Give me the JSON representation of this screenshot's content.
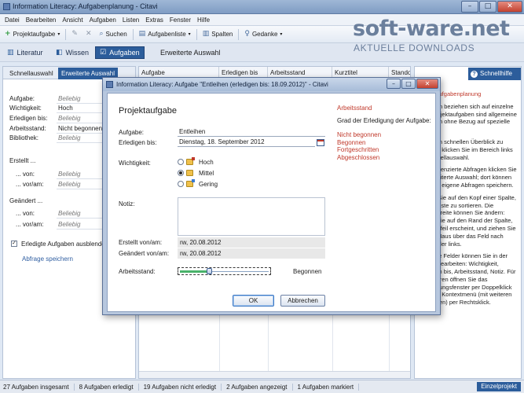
{
  "window": {
    "title": "Information Literacy: Aufgabenplanung - Citavi",
    "controls": [
      "–",
      "□",
      "✕"
    ]
  },
  "menu": [
    "Datei",
    "Bearbeiten",
    "Ansicht",
    "Aufgaben",
    "Listen",
    "Extras",
    "Fenster",
    "Hilfe"
  ],
  "toolbar": {
    "projektaufgabe": "Projektaufgabe",
    "suchen": "Suchen",
    "aufgabenliste": "Aufgabenliste",
    "spalten": "Spalten",
    "gedanke": "Gedanke"
  },
  "watermark": {
    "name": "soft-ware.net",
    "tagline": "AKTUELLE DOWNLOADS"
  },
  "nav": {
    "literatur": "Literatur",
    "wissen": "Wissen",
    "aufgaben": "Aufgaben",
    "heading": "Erweiterte Auswahl"
  },
  "left_panel": {
    "tabs": [
      "Schnellauswahl",
      "Erweiterte Auswahl"
    ],
    "fields": [
      {
        "label": "Aufgabe:",
        "value": "Beliebig",
        "filled": false
      },
      {
        "label": "Wichtigkeit:",
        "value": "Hoch",
        "filled": true
      },
      {
        "label": "Erledigen bis:",
        "value": "Beliebig",
        "filled": false
      },
      {
        "label": "Arbeitsstand:",
        "value": "Nicht begonnen",
        "filled": true
      },
      {
        "label": "Bibliothek:",
        "value": "Beliebig",
        "filled": false
      }
    ],
    "erstellt": "Erstellt ...",
    "erstellt_von": {
      "label": "... von:",
      "value": "Beliebig"
    },
    "erstellt_vonam": {
      "label": "... vor/am:",
      "value": "Beliebig"
    },
    "geaendert": "Geändert ...",
    "geaendert_von": {
      "label": "... von:",
      "value": "Beliebig"
    },
    "geaendert_vonam": {
      "label": "... vor/am:",
      "value": "Beliebig"
    },
    "checkbox_label": "Erledigte Aufgaben ausblenden",
    "checkbox_checked": true,
    "save_link": "Abfrage speichern"
  },
  "table": {
    "columns": [
      "Aufgabe",
      "Erledigen bis",
      "Arbeitsstand",
      "Kurztitel",
      "Stando"
    ]
  },
  "right_panel": {
    "header": "Schnellhilfe",
    "heading": "Projektaufgabenplanung",
    "paragraphs": [
      "Aufgaben beziehen sich auf einzelne Titel. Projektaufgaben sind allgemeine Aufgaben ohne Bezug auf spezielle Titel.",
      "Um einen schnellen Überblick zu erhalten, klicken Sie im Bereich links auf Schnellauswahl.",
      "Für differenzierte Abfragen klicken Sie auf Erweiterte Auswahl; dort können Sie auch eigene Abfragen speichern.",
      "Klicken Sie auf den Kopf einer Spalte, um die Liste zu sortieren. Die Spaltenbreite können Sie ändern: Zeigen Sie auf den Rand der Spalte, bis der Pfeil erscheint, und ziehen Sie mit der Maus über das Feld nach rechts oder links.",
      "Folgende Felder können Sie in der Tabelle bearbeiten: Wichtigkeit, Erledigen bis, Arbeitsstand, Notiz. Für die anderen öffnen Sie das Bearbeitungsfenster per Doppelklick oder das Kontextmenü (mit weiteren Angeboten) per Rechtsklick."
    ]
  },
  "status": {
    "items": [
      "27 Aufgaben insgesamt",
      "8 Aufgaben erledigt",
      "19 Aufgaben nicht erledigt",
      "2 Aufgaben angezeigt",
      "1 Aufgaben markiert"
    ],
    "button": "Einzelprojekt"
  },
  "dialog": {
    "title": "Information Literacy: Aufgabe \"Entleihen (erledigen bis: 18.09.2012)\" - Citavi",
    "heading": "Projektaufgabe",
    "aufgabe_label": "Aufgabe:",
    "aufgabe_value": "Entleihen",
    "erledigen_label": "Erledigen bis:",
    "erledigen_value": "Dienstag, 18. September 2012",
    "wichtigkeit_label": "Wichtigkeit:",
    "wichtigkeit_options": [
      {
        "label": "Hoch",
        "selected": false
      },
      {
        "label": "Mittel",
        "selected": true
      },
      {
        "label": "Gering",
        "selected": false
      }
    ],
    "notiz_label": "Notiz:",
    "erstellt_label": "Erstellt von/am:",
    "erstellt_value": "rw, 20.08.2012",
    "geaendert_label": "Geändert von/am:",
    "geaendert_value": "rw, 20.08.2012",
    "arbeitsstand_label": "Arbeitsstand:",
    "arbeitsstand_value": "Begonnen",
    "arbeitsstand_progress": 0.33,
    "ok": "OK",
    "cancel": "Abbrechen",
    "side": {
      "heading": "Arbeitsstand",
      "description": "Grad der Erledigung der Aufgabe:",
      "options": [
        "Nicht begonnen",
        "Begonnen",
        "Fortgeschritten",
        "Abgeschlossen"
      ]
    }
  },
  "colors": {
    "accent": "#2c5d9b",
    "highlight": "#c0392b"
  }
}
